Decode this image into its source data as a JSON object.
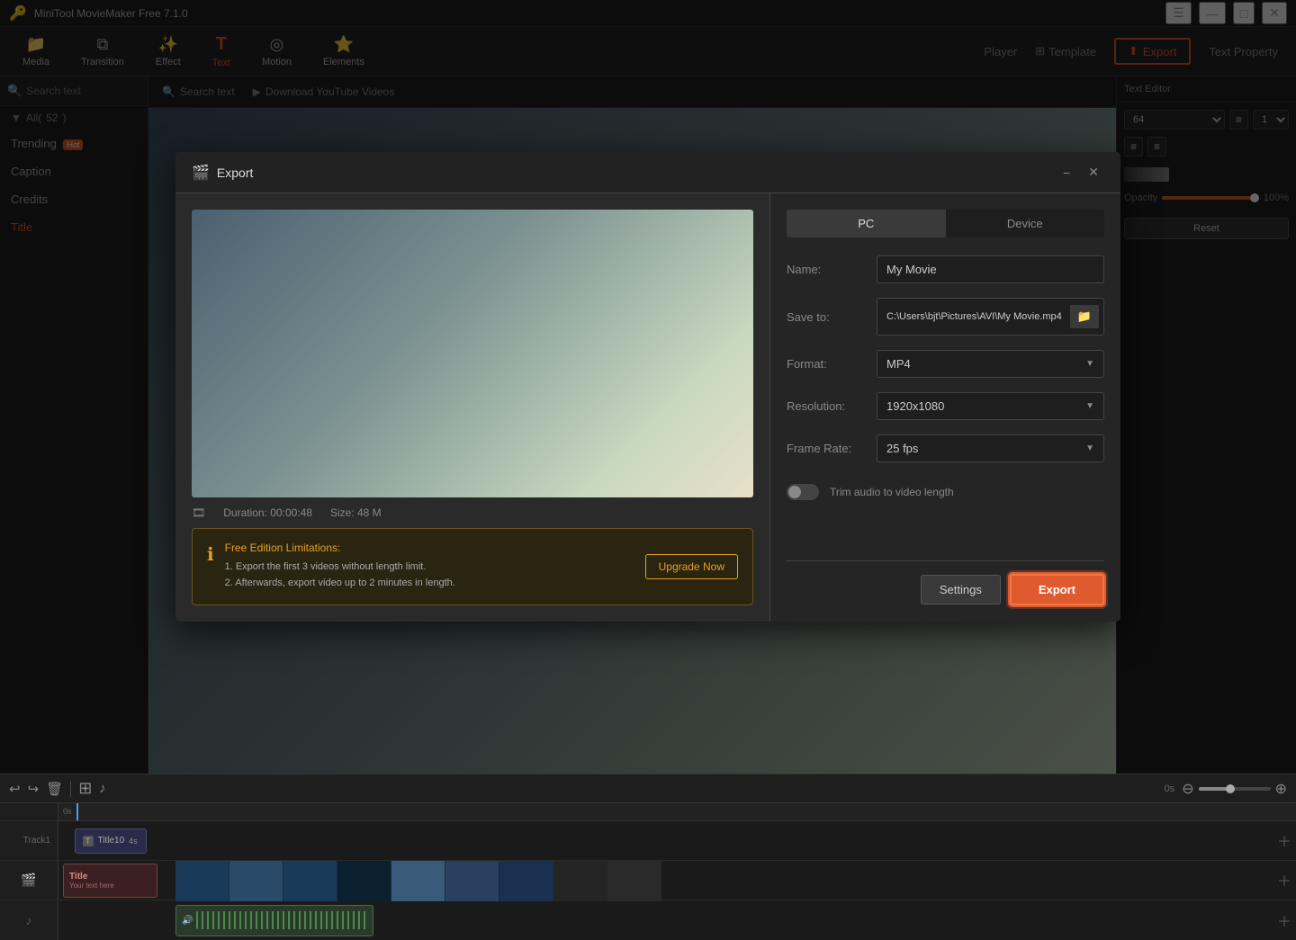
{
  "app": {
    "title": "MiniTool MovieMaker Free 7.1.0"
  },
  "titlebar": {
    "logo": "🔑",
    "title": "MiniTool MovieMaker Free 7.1.0",
    "menu_icon": "☰",
    "minimize": "—",
    "maximize": "□",
    "close": "✕"
  },
  "toolbar": {
    "items": [
      {
        "id": "media",
        "icon": "📁",
        "label": "Media"
      },
      {
        "id": "transition",
        "icon": "⧉",
        "label": "Transition"
      },
      {
        "id": "effect",
        "icon": "✨",
        "label": "Effect"
      },
      {
        "id": "text",
        "icon": "T",
        "label": "Text",
        "active": true
      },
      {
        "id": "motion",
        "icon": "◎",
        "label": "Motion"
      },
      {
        "id": "elements",
        "icon": "⭐",
        "label": "Elements"
      }
    ]
  },
  "sidebar": {
    "all_count": 52,
    "search_placeholder": "Search text",
    "items": [
      {
        "id": "trending",
        "label": "Trending",
        "badge": "Hot"
      },
      {
        "id": "caption",
        "label": "Caption"
      },
      {
        "id": "credits",
        "label": "Credits"
      },
      {
        "id": "title",
        "label": "Title",
        "active": true
      }
    ]
  },
  "top_nav": {
    "player": "Player",
    "template": "Template",
    "export": "Export",
    "text_property": "Text Property",
    "text_editor": "Text Editor"
  },
  "content_header": {
    "search_text": "Search text",
    "download": "Download YouTube Videos"
  },
  "right_panel": {
    "text_editor_label": "Text Editor",
    "reset_label": "Reset",
    "opacity_value": "100%"
  },
  "export_modal": {
    "title": "Export",
    "logo": "🎬",
    "mode_tabs": [
      {
        "id": "pc",
        "label": "PC",
        "active": true
      },
      {
        "id": "device",
        "label": "Device"
      }
    ],
    "fields": {
      "name_label": "Name:",
      "name_value": "My Movie",
      "save_to_label": "Save to:",
      "save_to_path": "C:\\Users\\bjt\\Pictures\\AVI\\My Movie.mp4",
      "format_label": "Format:",
      "format_value": "MP4",
      "resolution_label": "Resolution:",
      "resolution_value": "1920x1080",
      "frame_rate_label": "Frame Rate:",
      "frame_rate_value": "25 fps"
    },
    "toggle_label": "Trim audio to video length",
    "duration": "Duration: 00:00:48",
    "size": "Size: 48 M",
    "warning": {
      "title": "Free Edition Limitations:",
      "line1": "1. Export the first 3 videos without length limit.",
      "line2": "2. Afterwards, export video up to 2 minutes in length."
    },
    "upgrade_btn": "Upgrade Now",
    "settings_btn": "Settings",
    "export_btn": "Export",
    "minimize": "−",
    "close": "✕"
  },
  "timeline": {
    "undo_icon": "↩",
    "redo_icon": "↪",
    "delete_icon": "🗑",
    "add_media_icon": "＋",
    "add_audio_icon": "♪",
    "track_label": "Track1",
    "text_clip": "Title10",
    "text_clip_duration": "4s",
    "title_clip_label": "Title",
    "title_subtitle": "Your text here",
    "playhead_position": "0s"
  }
}
